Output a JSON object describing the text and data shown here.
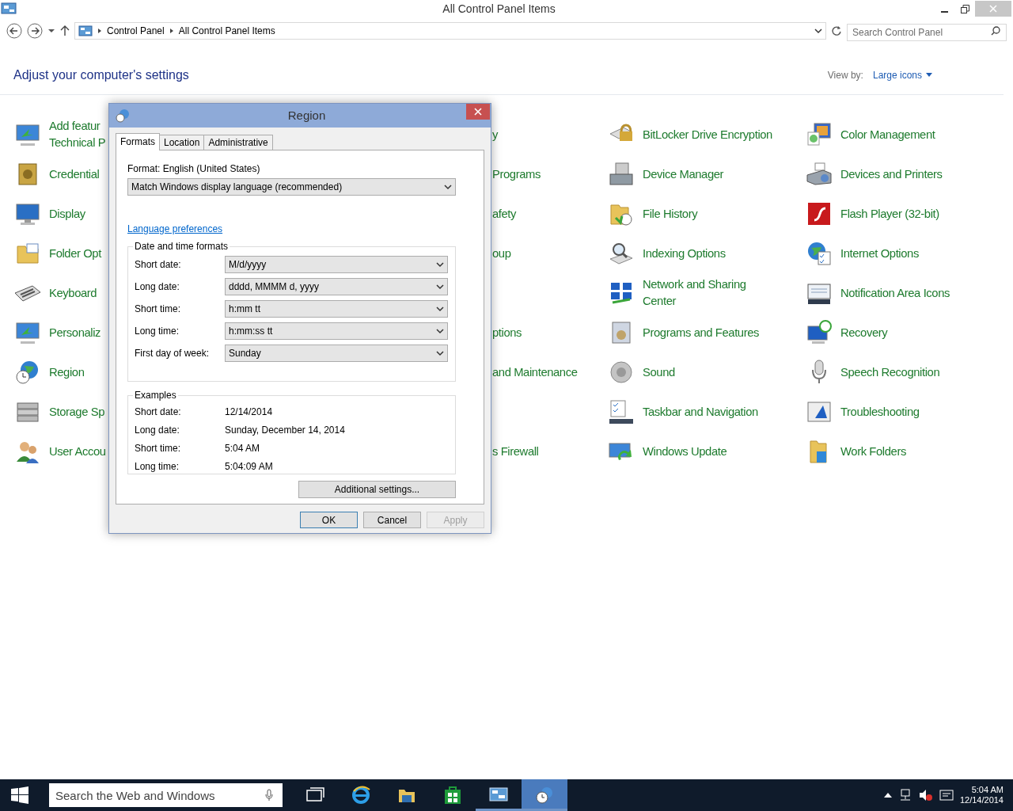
{
  "window": {
    "title": "All Control Panel Items"
  },
  "address_bar": {
    "breadcrumb": [
      "Control Panel",
      "All Control Panel Items"
    ],
    "search": {
      "placeholder": "Search Control Panel"
    }
  },
  "header": {
    "title": "Adjust your computer's settings",
    "view_by_label": "View by:",
    "view_by_value": "Large icons"
  },
  "item_columns": [
    {
      "items": [
        {
          "lines": [
            "Add featur",
            "Technical P"
          ]
        },
        {
          "lines": [
            "Credential"
          ]
        },
        {
          "lines": [
            "Display"
          ]
        },
        {
          "lines": [
            "Folder Opt"
          ]
        },
        {
          "lines": [
            "Keyboard"
          ]
        },
        {
          "lines": [
            "Personaliz"
          ]
        },
        {
          "lines": [
            "Region"
          ]
        },
        {
          "lines": [
            "Storage Sp"
          ]
        },
        {
          "lines": [
            "User Accou"
          ]
        }
      ]
    },
    {
      "items": [
        {
          "lines": [
            "y"
          ]
        },
        {
          "lines": [
            "Programs"
          ]
        },
        {
          "lines": [
            "afety"
          ]
        },
        {
          "lines": [
            "oup"
          ]
        },
        {
          "lines": [
            "ptions"
          ]
        },
        {
          "lines": [
            "and Maintenance"
          ]
        },
        {
          "lines": [
            "s Firewall"
          ]
        }
      ]
    },
    {
      "items": [
        {
          "lines": [
            "BitLocker Drive Encryption"
          ]
        },
        {
          "lines": [
            "Device Manager"
          ]
        },
        {
          "lines": [
            "File History"
          ]
        },
        {
          "lines": [
            "Indexing Options"
          ]
        },
        {
          "lines": [
            "Network and Sharing",
            "Center"
          ]
        },
        {
          "lines": [
            "Programs and Features"
          ]
        },
        {
          "lines": [
            "Sound"
          ]
        },
        {
          "lines": [
            "Taskbar and Navigation"
          ]
        },
        {
          "lines": [
            "Windows Update"
          ]
        }
      ]
    },
    {
      "items": [
        {
          "lines": [
            "Color Management"
          ]
        },
        {
          "lines": [
            "Devices and Printers"
          ]
        },
        {
          "lines": [
            "Flash Player (32-bit)"
          ]
        },
        {
          "lines": [
            "Internet Options"
          ]
        },
        {
          "lines": [
            "Notification Area Icons"
          ]
        },
        {
          "lines": [
            "Recovery"
          ]
        },
        {
          "lines": [
            "Speech Recognition"
          ]
        },
        {
          "lines": [
            "Troubleshooting"
          ]
        },
        {
          "lines": [
            "Work Folders"
          ]
        }
      ]
    }
  ],
  "dialog": {
    "title": "Region",
    "tabs": [
      {
        "label": "Formats",
        "selected": true
      },
      {
        "label": "Location",
        "selected": false
      },
      {
        "label": "Administrative",
        "selected": false
      }
    ],
    "format_label": "Format: English (United States)",
    "format_value": "Match Windows display language (recommended)",
    "link": "Language preferences",
    "formats_group": {
      "title": "Date and time formats",
      "rows": [
        {
          "label": "Short date:",
          "value": "M/d/yyyy"
        },
        {
          "label": "Long date:",
          "value": "dddd, MMMM d, yyyy"
        },
        {
          "label": "Short time:",
          "value": "h:mm tt"
        },
        {
          "label": "Long time:",
          "value": "h:mm:ss tt"
        },
        {
          "label": "First day of week:",
          "value": "Sunday"
        }
      ]
    },
    "examples_group": {
      "title": "Examples",
      "rows": [
        {
          "label": "Short date:",
          "value": "12/14/2014"
        },
        {
          "label": "Long date:",
          "value": "Sunday, December 14, 2014"
        },
        {
          "label": "Short time:",
          "value": "5:04 AM"
        },
        {
          "label": "Long time:",
          "value": "5:04:09 AM"
        }
      ]
    },
    "additional_button": "Additional settings...",
    "buttons": [
      {
        "label": "OK",
        "default": true,
        "disabled": false
      },
      {
        "label": "Cancel",
        "default": false,
        "disabled": false
      },
      {
        "label": "Apply",
        "default": false,
        "disabled": true
      }
    ]
  },
  "taskbar": {
    "search": {
      "placeholder": "Search the Web and Windows"
    },
    "apps": [
      {
        "running": false,
        "active": false
      },
      {
        "running": false,
        "active": false
      },
      {
        "running": false,
        "active": false
      },
      {
        "running": false,
        "active": false
      },
      {
        "running": true,
        "active": false
      },
      {
        "running": true,
        "active": true
      }
    ],
    "clock": {
      "time": "5:04 AM",
      "date": "12/14/2014"
    }
  }
}
